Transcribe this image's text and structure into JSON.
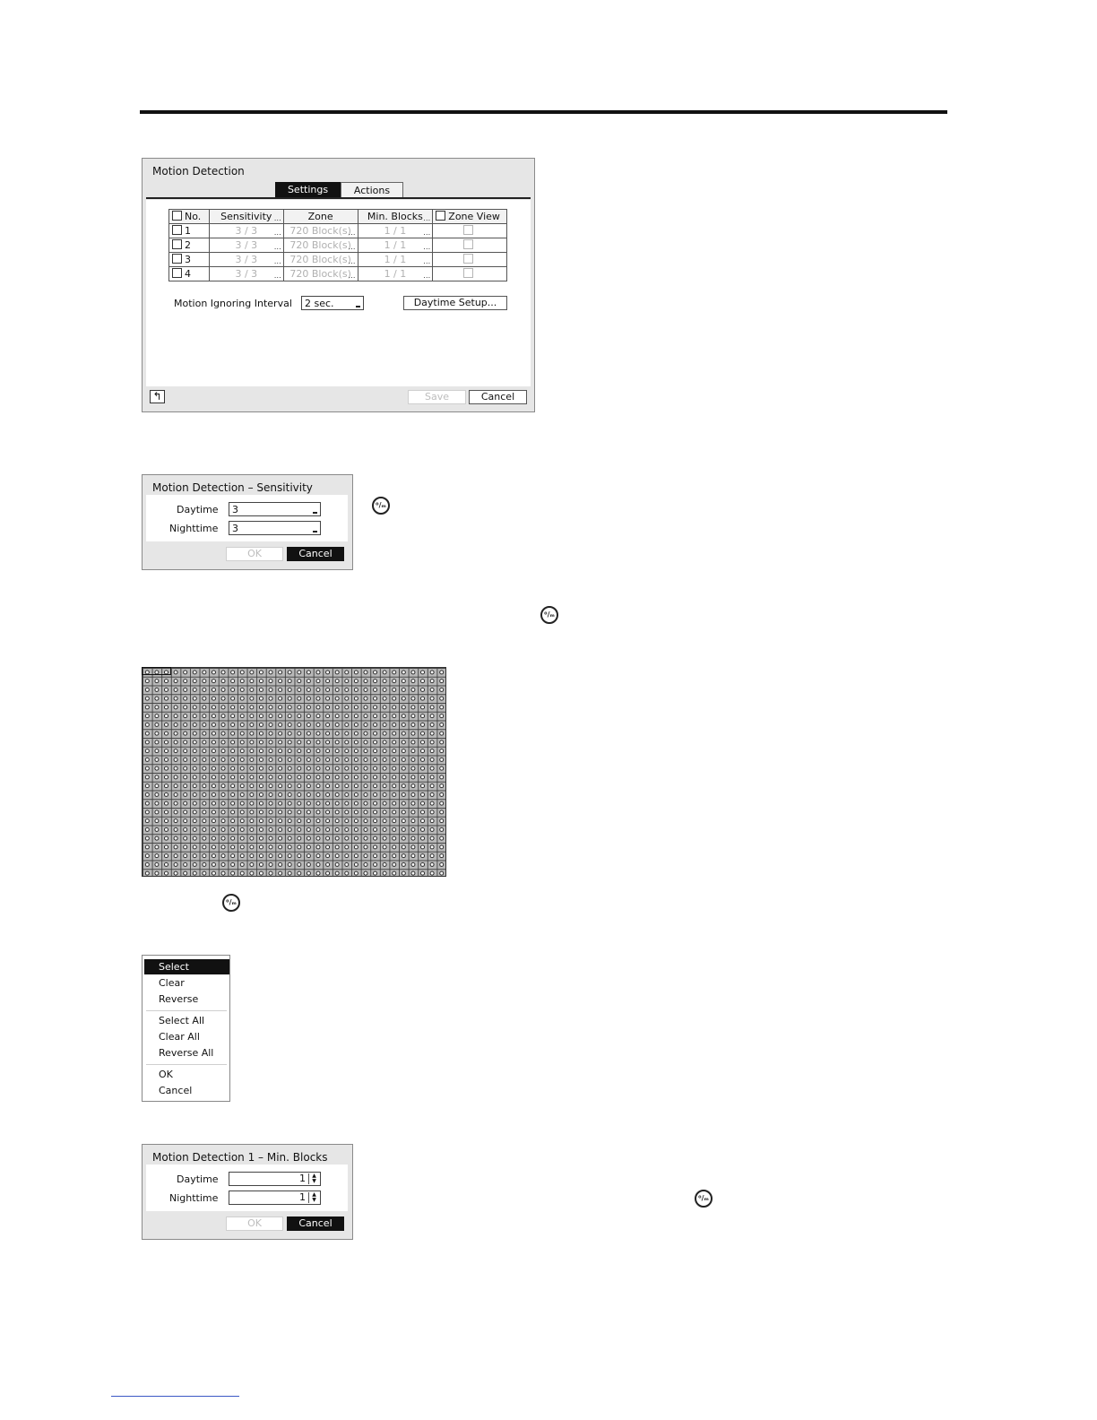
{
  "motion_detection": {
    "title": "Motion Detection",
    "tabs": [
      "Settings",
      "Actions"
    ],
    "columns": [
      "No.",
      "Sensitivity",
      "Zone",
      "Min. Blocks",
      "Zone View"
    ],
    "rows": [
      {
        "no": "1",
        "sensitivity": "3 / 3",
        "zone": "720 Block(s)",
        "min_blocks": "1 / 1"
      },
      {
        "no": "2",
        "sensitivity": "3 / 3",
        "zone": "720 Block(s)",
        "min_blocks": "1 / 1"
      },
      {
        "no": "3",
        "sensitivity": "3 / 3",
        "zone": "720 Block(s)",
        "min_blocks": "1 / 1"
      },
      {
        "no": "4",
        "sensitivity": "3 / 3",
        "zone": "720 Block(s)",
        "min_blocks": "1 / 1"
      }
    ],
    "interval_label": "Motion Ignoring Interval",
    "interval_value": "2 sec.",
    "daytime_setup_label": "Daytime Setup...",
    "save_label": "Save",
    "cancel_label": "Cancel",
    "back_icon": "undo-arrow-icon"
  },
  "sensitivity_dialog": {
    "title": "Motion Detection – Sensitivity",
    "daytime_label": "Daytime",
    "daytime_value": "3",
    "nighttime_label": "Nighttime",
    "nighttime_value": "3",
    "ok_label": "OK",
    "cancel_label": "Cancel"
  },
  "context_menu": {
    "items": [
      "Select",
      "Clear",
      "Reverse",
      "Select All",
      "Clear All",
      "Reverse All",
      "OK",
      "Cancel"
    ],
    "selected": "Select"
  },
  "min_blocks_dialog": {
    "title": "Motion Detection 1 – Min. Blocks",
    "daytime_label": "Daytime",
    "daytime_value": "1",
    "nighttime_label": "Nighttime",
    "nighttime_value": "1",
    "ok_label": "OK",
    "cancel_label": "Cancel"
  },
  "icons": {
    "remote_button": "remote-menu-button-icon",
    "remote_glyph": "⁰/ₘ"
  }
}
